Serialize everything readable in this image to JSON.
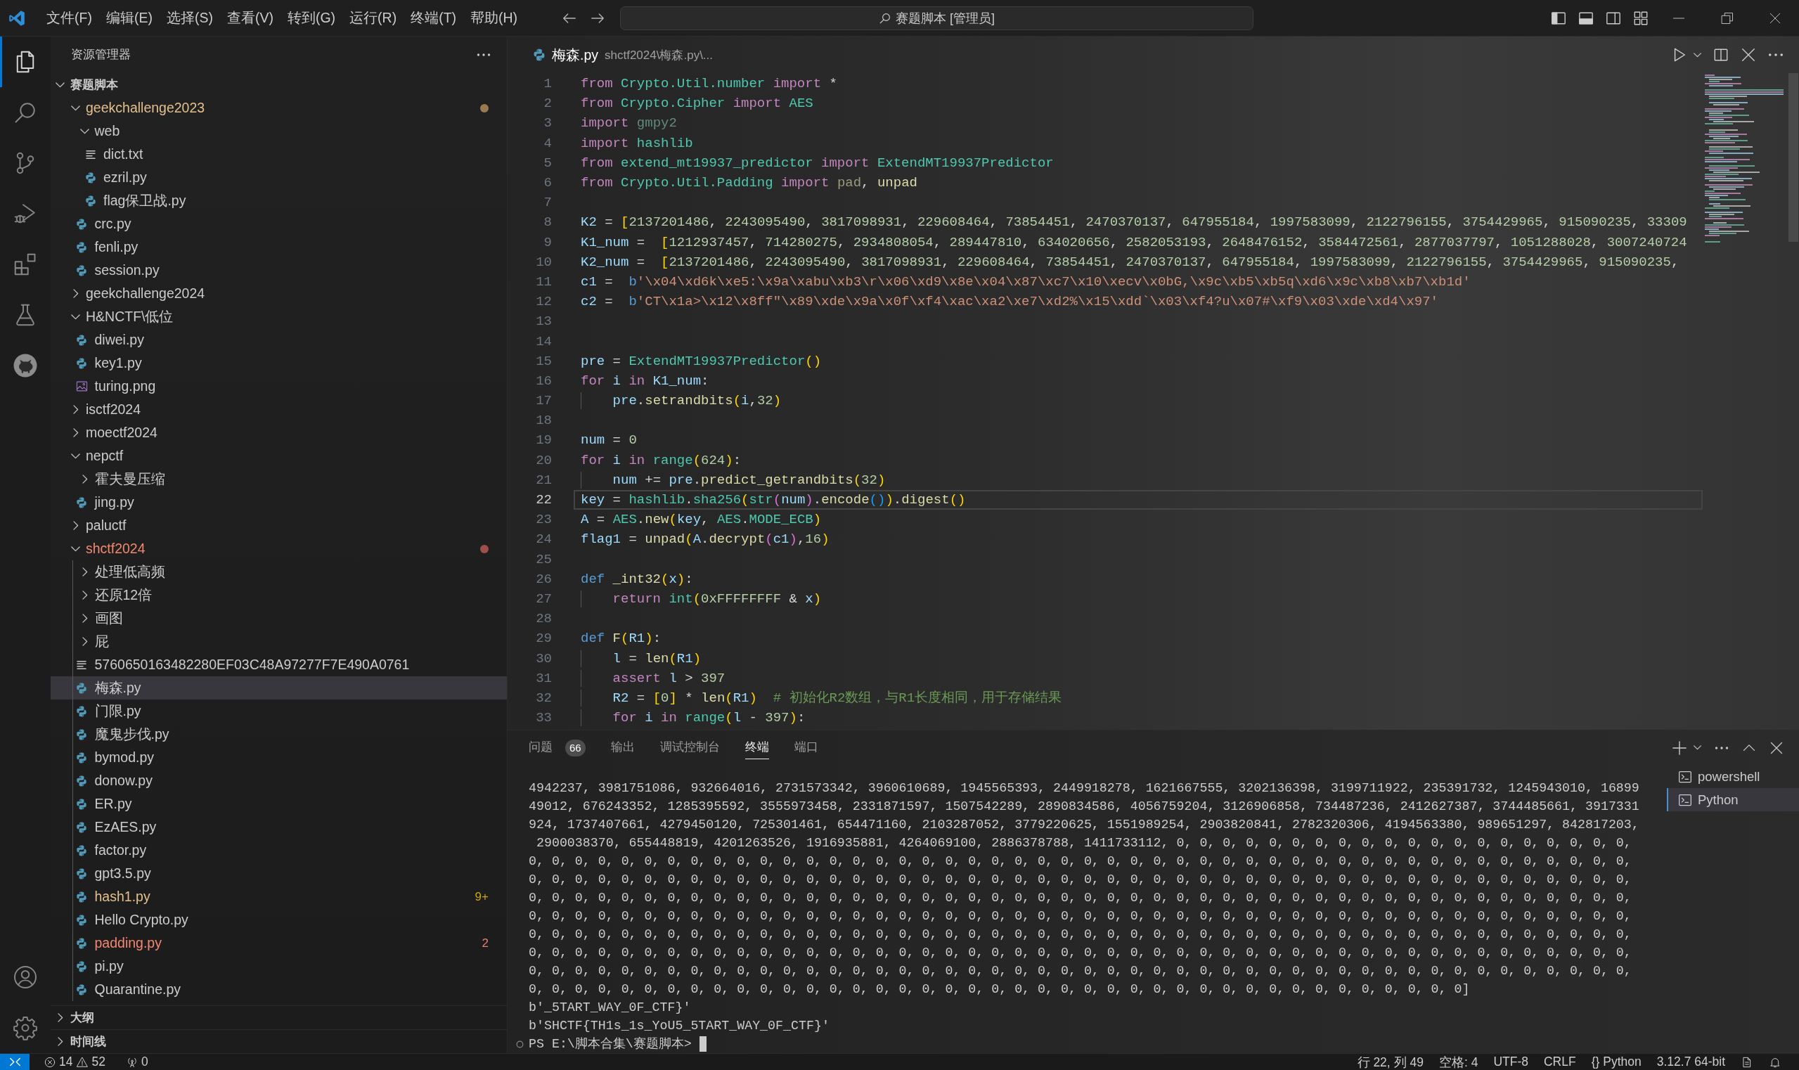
{
  "title_bar": {
    "menu": [
      "文件(F)",
      "编辑(E)",
      "选择(S)",
      "查看(V)",
      "转到(G)",
      "运行(R)",
      "终端(T)",
      "帮助(H)"
    ],
    "search": "赛题脚本 [管理员]"
  },
  "activity_bar": {
    "items": [
      {
        "selected": true
      },
      {
        "selected": false
      },
      {
        "selected": false
      },
      {
        "selected": false
      },
      {
        "selected": false
      },
      {
        "selected": false
      },
      {
        "selected": false
      }
    ]
  },
  "sidebar": {
    "title": "资源管理器",
    "root": {
      "label": "赛题脚本",
      "expanded": true,
      "children": [
        {
          "label": "geekchallenge2023",
          "kind": "folder",
          "expanded": true,
          "selected": false,
          "warning": true,
          "error": false,
          "children": [
            {
              "label": "web",
              "kind": "folder",
              "expanded": true,
              "selected": false,
              "warning": false,
              "error": false,
              "children": [
                {
                  "label": "dict.txt",
                  "kind": "text",
                  "selected": false,
                  "warning": false,
                  "error": false
                },
                {
                  "label": "ezril.py",
                  "kind": "python",
                  "selected": false,
                  "warning": false,
                  "error": false
                },
                {
                  "label": "flag保卫战.py",
                  "kind": "python",
                  "selected": false,
                  "warning": false,
                  "error": false
                }
              ]
            },
            {
              "label": "crc.py",
              "kind": "python",
              "selected": false,
              "warning": false,
              "error": false
            },
            {
              "label": "fenli.py",
              "kind": "python",
              "selected": false,
              "warning": false,
              "error": false
            },
            {
              "label": "session.py",
              "kind": "python",
              "selected": false,
              "warning": false,
              "error": false
            }
          ]
        },
        {
          "label": "geekchallenge2024",
          "kind": "folder",
          "expanded": false,
          "selected": false,
          "warning": false,
          "error": false
        },
        {
          "label": "H&NCTF\\低位",
          "kind": "folder",
          "expanded": true,
          "selected": false,
          "warning": false,
          "error": false,
          "children": [
            {
              "label": "diwei.py",
              "kind": "python",
              "selected": false,
              "warning": false,
              "error": false
            },
            {
              "label": "key1.py",
              "kind": "python",
              "selected": false,
              "warning": false,
              "error": false
            },
            {
              "label": "turing.png",
              "kind": "image",
              "selected": false,
              "warning": false,
              "error": false
            }
          ]
        },
        {
          "label": "isctf2024",
          "kind": "folder",
          "expanded": false,
          "selected": false,
          "warning": false,
          "error": false
        },
        {
          "label": "moectf2024",
          "kind": "folder",
          "expanded": false,
          "selected": false,
          "warning": false,
          "error": false
        },
        {
          "label": "nepctf",
          "kind": "folder",
          "expanded": true,
          "selected": false,
          "warning": false,
          "error": false,
          "children": [
            {
              "label": "霍夫曼压缩",
              "kind": "folder",
              "expanded": false,
              "selected": false,
              "warning": false,
              "error": false
            },
            {
              "label": "jing.py",
              "kind": "python",
              "selected": false,
              "warning": false,
              "error": false
            }
          ]
        },
        {
          "label": "paluctf",
          "kind": "folder",
          "expanded": false,
          "selected": false,
          "warning": false,
          "error": false
        },
        {
          "label": "shctf2024",
          "kind": "folder",
          "expanded": true,
          "selected": false,
          "warning": false,
          "error": true,
          "children": [
            {
              "label": "处理低高频",
              "kind": "folder",
              "expanded": false,
              "selected": false,
              "warning": false,
              "error": false
            },
            {
              "label": "还原12倍",
              "kind": "folder",
              "expanded": false,
              "selected": false,
              "warning": false,
              "error": false
            },
            {
              "label": "画图",
              "kind": "folder",
              "expanded": false,
              "selected": false,
              "warning": false,
              "error": false
            },
            {
              "label": "屁",
              "kind": "folder",
              "expanded": false,
              "selected": false,
              "warning": false,
              "error": false
            },
            {
              "label": "5760650163482280EF03C48A97277F7E490A0761",
              "kind": "text",
              "selected": false,
              "warning": false,
              "error": false
            },
            {
              "label": "梅森.py",
              "kind": "python",
              "selected": true,
              "warning": false,
              "error": false
            },
            {
              "label": "门限.py",
              "kind": "python",
              "selected": false,
              "warning": false,
              "error": false
            },
            {
              "label": "魔鬼步伐.py",
              "kind": "python",
              "selected": false,
              "warning": false,
              "error": false
            },
            {
              "label": "bymod.py",
              "kind": "python",
              "selected": false,
              "warning": false,
              "error": false
            },
            {
              "label": "donow.py",
              "kind": "python",
              "selected": false,
              "warning": false,
              "error": false
            },
            {
              "label": "ER.py",
              "kind": "python",
              "selected": false,
              "warning": false,
              "error": false
            },
            {
              "label": "EzAES.py",
              "kind": "python",
              "selected": false,
              "warning": false,
              "error": false
            },
            {
              "label": "factor.py",
              "kind": "python",
              "selected": false,
              "warning": false,
              "error": false
            },
            {
              "label": "gpt3.5.py",
              "kind": "python",
              "selected": false,
              "warning": false,
              "error": false
            },
            {
              "label": "hash1.py",
              "kind": "python",
              "selected": false,
              "warning": true,
              "error": false,
              "badge": "9+"
            },
            {
              "label": "Hello Crypto.py",
              "kind": "python",
              "selected": false,
              "warning": false,
              "error": false
            },
            {
              "label": "padding.py",
              "kind": "python",
              "selected": false,
              "warning": false,
              "error": true,
              "badge": "2"
            },
            {
              "label": "pi.py",
              "kind": "python",
              "selected": false,
              "warning": false,
              "error": false
            },
            {
              "label": "Quarantine.py",
              "kind": "python",
              "selected": false,
              "warning": false,
              "error": false
            }
          ]
        }
      ]
    },
    "sections": [
      {
        "label": "大纲",
        "expanded": false
      },
      {
        "label": "时间线",
        "expanded": false
      }
    ]
  },
  "editor": {
    "tab": {
      "label": "梅森.py",
      "description": "shctf2024\\梅森.py\\..."
    },
    "lines": [
      {
        "number": "1",
        "current": false,
        "tokens": [
          {
            "text": "from ",
            "kind": "kw"
          },
          {
            "text": "Crypto.Util.number ",
            "kind": "type"
          },
          {
            "text": "import",
            "kind": "kw"
          },
          {
            "text": " *",
            "kind": "plain"
          }
        ]
      },
      {
        "number": "2",
        "current": false,
        "tokens": [
          {
            "text": "from ",
            "kind": "kw"
          },
          {
            "text": "Crypto.Cipher ",
            "kind": "type"
          },
          {
            "text": "import ",
            "kind": "kw"
          },
          {
            "text": "AES",
            "kind": "type"
          }
        ]
      },
      {
        "number": "3",
        "current": false,
        "tokens": [
          {
            "text": "import ",
            "kind": "kw"
          },
          {
            "text": "gmpy2",
            "kind": "faded"
          }
        ]
      },
      {
        "number": "4",
        "current": false,
        "tokens": [
          {
            "text": "import ",
            "kind": "kw"
          },
          {
            "text": "hashlib",
            "kind": "type"
          }
        ]
      },
      {
        "number": "5",
        "current": false,
        "tokens": [
          {
            "text": "from ",
            "kind": "kw"
          },
          {
            "text": "extend_mt19937_predictor ",
            "kind": "type"
          },
          {
            "text": "import ",
            "kind": "kw"
          },
          {
            "text": "ExtendMT19937Predictor",
            "kind": "type"
          }
        ]
      },
      {
        "number": "6",
        "current": false,
        "tokens": [
          {
            "text": "from ",
            "kind": "kw"
          },
          {
            "text": "Crypto.Util.Padding ",
            "kind": "type"
          },
          {
            "text": "import ",
            "kind": "kw"
          },
          {
            "text": "pad",
            "kind": "fadedfn"
          },
          {
            "text": ", ",
            "kind": "plain"
          },
          {
            "text": "unpad",
            "kind": "fn"
          }
        ]
      },
      {
        "number": "7",
        "current": false
      },
      {
        "number": "8",
        "current": false,
        "tokens": [
          {
            "text": "K2",
            "kind": "var"
          },
          {
            "text": " = ",
            "kind": "plain"
          },
          {
            "text": "[",
            "kind": "br1"
          },
          {
            "text": "2137201486, 2243095490, 3817098931, 229608464, 73854451, 2470370137, 647955184, 1997583099, 2122796155, 3754429965, 915090235, 33309",
            "kind": "nums"
          }
        ]
      },
      {
        "number": "9",
        "current": false,
        "tokens": [
          {
            "text": "K1_num",
            "kind": "var"
          },
          {
            "text": " =  ",
            "kind": "plain"
          },
          {
            "text": "[",
            "kind": "br1"
          },
          {
            "text": "1212937457, 714280275, 2934808054, 289447810, 634020656, 2582053193, 2648476152, 3584472561, 2877037797, 1051288028, 3007240724",
            "kind": "nums"
          }
        ]
      },
      {
        "number": "10",
        "current": false,
        "tokens": [
          {
            "text": "K2_num",
            "kind": "var"
          },
          {
            "text": " =  ",
            "kind": "plain"
          },
          {
            "text": "[",
            "kind": "br1"
          },
          {
            "text": "2137201486, 2243095490, 3817098931, 229608464, 73854451, 2470370137, 647955184, 1997583099, 2122796155, 3754429965, 915090235,",
            "kind": "nums"
          }
        ]
      },
      {
        "number": "11",
        "current": false,
        "tokens": [
          {
            "text": "c1",
            "kind": "var"
          },
          {
            "text": " =  ",
            "kind": "plain"
          },
          {
            "text": "b",
            "kind": "storage"
          },
          {
            "text": "'\\x04\\xd6k\\xe5:\\x9a\\xabu\\xb3\\r\\x06\\xd9\\x8e\\x04\\x87\\xc7\\x10\\xecv\\x0bG,\\x9c\\xb5\\xb5q\\xd6\\x9c\\xb8\\xb7\\xb1d'",
            "kind": "str"
          }
        ]
      },
      {
        "number": "12",
        "current": false,
        "tokens": [
          {
            "text": "c2",
            "kind": "var"
          },
          {
            "text": " =  ",
            "kind": "plain"
          },
          {
            "text": "b",
            "kind": "storage"
          },
          {
            "text": "'CT\\x1a>\\x12\\x8ff\"\\x89\\xde\\x9a\\x0f\\xf4\\xac\\xa2\\xe7\\xd2%\\x15\\xdd`\\x03\\xf4?u\\x07#\\xf9\\x03\\xde\\xd4\\x97'",
            "kind": "str"
          }
        ]
      },
      {
        "number": "13",
        "current": false
      },
      {
        "number": "14",
        "current": false
      },
      {
        "number": "15",
        "current": false,
        "tokens": [
          {
            "text": "pre",
            "kind": "var"
          },
          {
            "text": " = ",
            "kind": "plain"
          },
          {
            "text": "ExtendMT19937Predictor",
            "kind": "type"
          },
          {
            "text": "()",
            "kind": "br1"
          }
        ]
      },
      {
        "number": "16",
        "current": false,
        "tokens": [
          {
            "text": "for ",
            "kind": "kw"
          },
          {
            "text": "i ",
            "kind": "var"
          },
          {
            "text": "in ",
            "kind": "kw"
          },
          {
            "text": "K1_num",
            "kind": "var"
          },
          {
            "text": ":",
            "kind": "plain"
          }
        ]
      },
      {
        "number": "17",
        "current": false,
        "tokens": [
          {
            "text": "    pre",
            "kind": "var"
          },
          {
            "text": ".",
            "kind": "plain"
          },
          {
            "text": "setrandbits",
            "kind": "fn"
          },
          {
            "text": "(",
            "kind": "br1"
          },
          {
            "text": "i",
            "kind": "var"
          },
          {
            "text": ",",
            "kind": "plain"
          },
          {
            "text": "32",
            "kind": "num"
          },
          {
            "text": ")",
            "kind": "br1"
          }
        ]
      },
      {
        "number": "18",
        "current": false
      },
      {
        "number": "19",
        "current": false,
        "tokens": [
          {
            "text": "num",
            "kind": "var"
          },
          {
            "text": " = ",
            "kind": "plain"
          },
          {
            "text": "0",
            "kind": "num"
          }
        ]
      },
      {
        "number": "20",
        "current": false,
        "tokens": [
          {
            "text": "for ",
            "kind": "kw"
          },
          {
            "text": "i ",
            "kind": "var"
          },
          {
            "text": "in ",
            "kind": "kw"
          },
          {
            "text": "range",
            "kind": "type"
          },
          {
            "text": "(",
            "kind": "br1"
          },
          {
            "text": "624",
            "kind": "num"
          },
          {
            "text": ")",
            "kind": "br1"
          },
          {
            "text": ":",
            "kind": "plain"
          }
        ]
      },
      {
        "number": "21",
        "current": false,
        "tokens": [
          {
            "text": "    num",
            "kind": "var"
          },
          {
            "text": " += ",
            "kind": "plain"
          },
          {
            "text": "pre",
            "kind": "var"
          },
          {
            "text": ".",
            "kind": "plain"
          },
          {
            "text": "predict_getrandbits",
            "kind": "fn"
          },
          {
            "text": "(",
            "kind": "br1"
          },
          {
            "text": "32",
            "kind": "num"
          },
          {
            "text": ")",
            "kind": "br1"
          }
        ]
      },
      {
        "number": "22",
        "current": true,
        "tokens": [
          {
            "text": "key",
            "kind": "var"
          },
          {
            "text": " = ",
            "kind": "plain"
          },
          {
            "text": "hashlib",
            "kind": "type"
          },
          {
            "text": ".",
            "kind": "plain"
          },
          {
            "text": "sha256",
            "kind": "type"
          },
          {
            "text": "(",
            "kind": "br1"
          },
          {
            "text": "str",
            "kind": "type"
          },
          {
            "text": "(",
            "kind": "br2"
          },
          {
            "text": "num",
            "kind": "var"
          },
          {
            "text": ")",
            "kind": "br2"
          },
          {
            "text": ".",
            "kind": "plain"
          },
          {
            "text": "encode",
            "kind": "fn"
          },
          {
            "text": "()",
            "kind": "br3"
          },
          {
            "text": ")",
            "kind": "br1"
          },
          {
            "text": ".",
            "kind": "plain"
          },
          {
            "text": "digest",
            "kind": "fn"
          },
          {
            "text": "()",
            "kind": "br1"
          }
        ]
      },
      {
        "number": "23",
        "current": false,
        "tokens": [
          {
            "text": "A",
            "kind": "var"
          },
          {
            "text": " = ",
            "kind": "plain"
          },
          {
            "text": "AES",
            "kind": "type"
          },
          {
            "text": ".",
            "kind": "plain"
          },
          {
            "text": "new",
            "kind": "fn"
          },
          {
            "text": "(",
            "kind": "br1"
          },
          {
            "text": "key",
            "kind": "var"
          },
          {
            "text": ", ",
            "kind": "plain"
          },
          {
            "text": "AES",
            "kind": "type"
          },
          {
            "text": ".",
            "kind": "plain"
          },
          {
            "text": "MODE_ECB",
            "kind": "type"
          },
          {
            "text": ")",
            "kind": "br1"
          }
        ]
      },
      {
        "number": "24",
        "current": false,
        "tokens": [
          {
            "text": "flag1",
            "kind": "var"
          },
          {
            "text": " = ",
            "kind": "plain"
          },
          {
            "text": "unpad",
            "kind": "fn"
          },
          {
            "text": "(",
            "kind": "br1"
          },
          {
            "text": "A",
            "kind": "var"
          },
          {
            "text": ".",
            "kind": "plain"
          },
          {
            "text": "decrypt",
            "kind": "fn"
          },
          {
            "text": "(",
            "kind": "br2"
          },
          {
            "text": "c1",
            "kind": "var"
          },
          {
            "text": ")",
            "kind": "br2"
          },
          {
            "text": ",",
            "kind": "plain"
          },
          {
            "text": "16",
            "kind": "num"
          },
          {
            "text": ")",
            "kind": "br1"
          }
        ]
      },
      {
        "number": "25",
        "current": false
      },
      {
        "number": "26",
        "current": false,
        "tokens": [
          {
            "text": "def ",
            "kind": "storage"
          },
          {
            "text": "_int32",
            "kind": "fn"
          },
          {
            "text": "(",
            "kind": "br1"
          },
          {
            "text": "x",
            "kind": "var"
          },
          {
            "text": ")",
            "kind": "br1"
          },
          {
            "text": ":",
            "kind": "plain"
          }
        ]
      },
      {
        "number": "27",
        "current": false,
        "tokens": [
          {
            "text": "    return ",
            "kind": "kw"
          },
          {
            "text": "int",
            "kind": "type"
          },
          {
            "text": "(",
            "kind": "br1"
          },
          {
            "text": "0xFFFFFFFF",
            "kind": "num"
          },
          {
            "text": " & ",
            "kind": "plain"
          },
          {
            "text": "x",
            "kind": "var"
          },
          {
            "text": ")",
            "kind": "br1"
          }
        ]
      },
      {
        "number": "28",
        "current": false
      },
      {
        "number": "29",
        "current": false,
        "tokens": [
          {
            "text": "def ",
            "kind": "storage"
          },
          {
            "text": "F",
            "kind": "fn"
          },
          {
            "text": "(",
            "kind": "br1"
          },
          {
            "text": "R1",
            "kind": "var"
          },
          {
            "text": ")",
            "kind": "br1"
          },
          {
            "text": ":",
            "kind": "plain"
          }
        ]
      },
      {
        "number": "30",
        "current": false,
        "tokens": [
          {
            "text": "    l",
            "kind": "var"
          },
          {
            "text": " = ",
            "kind": "plain"
          },
          {
            "text": "len",
            "kind": "fn"
          },
          {
            "text": "(",
            "kind": "br1"
          },
          {
            "text": "R1",
            "kind": "var"
          },
          {
            "text": ")",
            "kind": "br1"
          }
        ]
      },
      {
        "number": "31",
        "current": false,
        "tokens": [
          {
            "text": "    assert ",
            "kind": "kw"
          },
          {
            "text": "l",
            "kind": "var"
          },
          {
            "text": " > ",
            "kind": "plain"
          },
          {
            "text": "397",
            "kind": "num"
          }
        ]
      },
      {
        "number": "32",
        "current": false,
        "tokens": [
          {
            "text": "    R2",
            "kind": "var"
          },
          {
            "text": " = ",
            "kind": "plain"
          },
          {
            "text": "[",
            "kind": "br1"
          },
          {
            "text": "0",
            "kind": "num"
          },
          {
            "text": "]",
            "kind": "br1"
          },
          {
            "text": " * ",
            "kind": "plain"
          },
          {
            "text": "len",
            "kind": "fn"
          },
          {
            "text": "(",
            "kind": "br1"
          },
          {
            "text": "R1",
            "kind": "var"
          },
          {
            "text": ")",
            "kind": "br1"
          },
          {
            "text": "  # 初始化R2数组，与R1长度相同，用于存储结果",
            "kind": "cmt"
          }
        ]
      },
      {
        "number": "33",
        "current": false,
        "tokens": [
          {
            "text": "    for ",
            "kind": "kw"
          },
          {
            "text": "i ",
            "kind": "var"
          },
          {
            "text": "in ",
            "kind": "kw"
          },
          {
            "text": "range",
            "kind": "type"
          },
          {
            "text": "(",
            "kind": "br1"
          },
          {
            "text": "l",
            "kind": "var"
          },
          {
            "text": " - ",
            "kind": "plain"
          },
          {
            "text": "397",
            "kind": "num"
          },
          {
            "text": ")",
            "kind": "br1"
          },
          {
            "text": ":",
            "kind": "plain"
          }
        ]
      }
    ]
  },
  "panel": {
    "tabs": [
      {
        "label": "问题",
        "badge": "66",
        "selected": false
      },
      {
        "label": "输出",
        "selected": false
      },
      {
        "label": "调试控制台",
        "selected": false
      },
      {
        "label": "终端",
        "selected": true
      },
      {
        "label": "端口",
        "selected": false
      }
    ],
    "terminal": {
      "lines": [
        "4942237, 3981751086, 932664016, 2731573342, 3960610689, 1945565393, 2449918278, 1621667555, 3202136398, 3199711922, 235391732, 1245943010, 16899",
        "49012, 676243352, 1285395592, 3555973458, 2331871597, 1507542289, 2890834586, 4056759204, 3126906858, 734487236, 2412627387, 3744485661, 3917331",
        "924, 1737407661, 4279450120, 725301461, 654471160, 2103287052, 3779220625, 1551989254, 2903820841, 2782320306, 4194563380, 989651297, 842817203,",
        " 2900038370, 655448819, 4201263526, 1916935881, 4264069100, 2886378788, 1411733112, 0, 0, 0, 0, 0, 0, 0, 0, 0, 0, 0, 0, 0, 0, 0, 0, 0, 0, 0, 0,",
        "0, 0, 0, 0, 0, 0, 0, 0, 0, 0, 0, 0, 0, 0, 0, 0, 0, 0, 0, 0, 0, 0, 0, 0, 0, 0, 0, 0, 0, 0, 0, 0, 0, 0, 0, 0, 0, 0, 0, 0, 0, 0, 0, 0, 0, 0, 0, 0,",
        "0, 0, 0, 0, 0, 0, 0, 0, 0, 0, 0, 0, 0, 0, 0, 0, 0, 0, 0, 0, 0, 0, 0, 0, 0, 0, 0, 0, 0, 0, 0, 0, 0, 0, 0, 0, 0, 0, 0, 0, 0, 0, 0, 0, 0, 0, 0, 0,",
        "0, 0, 0, 0, 0, 0, 0, 0, 0, 0, 0, 0, 0, 0, 0, 0, 0, 0, 0, 0, 0, 0, 0, 0, 0, 0, 0, 0, 0, 0, 0, 0, 0, 0, 0, 0, 0, 0, 0, 0, 0, 0, 0, 0, 0, 0, 0, 0,",
        "0, 0, 0, 0, 0, 0, 0, 0, 0, 0, 0, 0, 0, 0, 0, 0, 0, 0, 0, 0, 0, 0, 0, 0, 0, 0, 0, 0, 0, 0, 0, 0, 0, 0, 0, 0, 0, 0, 0, 0, 0, 0, 0, 0, 0, 0, 0, 0,",
        "0, 0, 0, 0, 0, 0, 0, 0, 0, 0, 0, 0, 0, 0, 0, 0, 0, 0, 0, 0, 0, 0, 0, 0, 0, 0, 0, 0, 0, 0, 0, 0, 0, 0, 0, 0, 0, 0, 0, 0, 0, 0, 0, 0, 0, 0, 0, 0,",
        "0, 0, 0, 0, 0, 0, 0, 0, 0, 0, 0, 0, 0, 0, 0, 0, 0, 0, 0, 0, 0, 0, 0, 0, 0, 0, 0, 0, 0, 0, 0, 0, 0, 0, 0, 0, 0, 0, 0, 0, 0, 0, 0, 0, 0, 0, 0, 0,",
        "0, 0, 0, 0, 0, 0, 0, 0, 0, 0, 0, 0, 0, 0, 0, 0, 0, 0, 0, 0, 0, 0, 0, 0, 0, 0, 0, 0, 0, 0, 0, 0, 0, 0, 0, 0, 0, 0, 0, 0, 0, 0, 0, 0, 0, 0, 0, 0,",
        "0, 0, 0, 0, 0, 0, 0, 0, 0, 0, 0, 0, 0, 0, 0, 0, 0, 0, 0, 0, 0, 0, 0, 0, 0, 0, 0, 0, 0, 0, 0, 0, 0, 0, 0, 0, 0, 0, 0, 0, 0]",
        "b'_5TART_WAY_0F_CTF}'",
        "b'SHCTF{TH1s_1s_YoU5_5TART_WAY_0F_CTF}'"
      ],
      "prompt": "PS E:\\脚本合集\\赛题脚本> "
    },
    "terminals": [
      {
        "label": "powershell",
        "selected": false
      },
      {
        "label": "Python",
        "selected": true
      }
    ]
  },
  "status_bar": {
    "errors": "14",
    "warnings": "52",
    "ports": "0",
    "items": [
      "行 22, 列 49",
      "空格: 4",
      "UTF-8",
      "CRLF",
      "{} Python",
      "3.12.7 64-bit"
    ]
  }
}
